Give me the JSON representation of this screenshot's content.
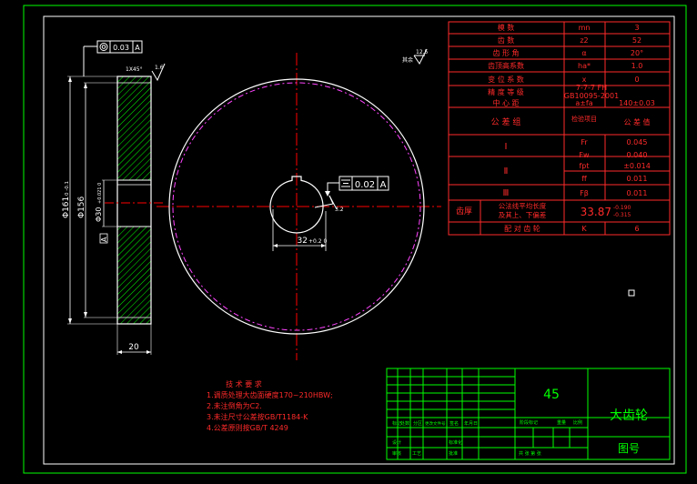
{
  "gear_table": {
    "rows": [
      {
        "label": "模 数",
        "symbol": "mn",
        "value": "3"
      },
      {
        "label": "齿 数",
        "symbol": "z2",
        "value": "52"
      },
      {
        "label": "齿 形 角",
        "symbol": "α",
        "value": "20°"
      },
      {
        "label": "齿顶高系数",
        "symbol": "ha*",
        "value": "1.0"
      },
      {
        "label": "变 位 系 数",
        "symbol": "x",
        "value": "0"
      },
      {
        "label": "精 度 等 级",
        "symbol": "",
        "value": "7-7-7 FH"
      },
      {
        "label": "",
        "symbol": "",
        "value": "GB10095-2001"
      },
      {
        "label": "中 心 距",
        "symbol": "a±fa",
        "value": "140±0.03"
      }
    ],
    "tolerance_header": {
      "group": "公 差 组",
      "item": "检验项目",
      "value": "公 差 值"
    },
    "groups": [
      "Ⅰ",
      "Ⅱ",
      "Ⅲ"
    ],
    "tolerance_rows": [
      {
        "symbol": "Fr",
        "value": "0.045"
      },
      {
        "symbol": "Fw",
        "value": "0.040"
      },
      {
        "symbol": "fpt",
        "value": "±0.014"
      },
      {
        "symbol": "ff",
        "value": "0.011"
      },
      {
        "symbol": "Fβ",
        "value": "0.011"
      }
    ],
    "tooth_thickness": {
      "left": "齿厚",
      "desc1": "公法线平均长度",
      "desc2": "及其上、下偏差",
      "value": "33.87",
      "upper": "-0.190",
      "lower": "-0.315"
    },
    "mate": {
      "label": "配 对 齿 轮",
      "symbol": "K",
      "value": "6"
    }
  },
  "dimensions": {
    "tol_frame1": "0.03",
    "tol_frame1_ref": "A",
    "chamfer": "1X45°",
    "rough1": "1.6",
    "rough_rest": "12.5",
    "rest_label": "其余",
    "dia_outer": "Φ161",
    "dia_outer_tol": "0 -0.1",
    "dia_mid": "Φ156",
    "dia_bore": "Φ30",
    "dia_bore_tol": "+0.021 0",
    "datum": "A",
    "width": "20",
    "keyway": "32",
    "keyway_tol": "+0.2 0",
    "tol_frame2": "0.02",
    "tol_frame2_ref": "A",
    "rough2": "3.2"
  },
  "tech_notes": {
    "title": "技 术 要 求",
    "items": [
      "1.调质处理大齿面硬度170~210HBW;",
      "2.未注倒角为C2.",
      "3.未注尺寸公差按GB/T1184-K",
      "4.公差原则按GB/T 4249"
    ]
  },
  "title_block": {
    "material": "45",
    "name": "大齿轮",
    "drawing_no_label": "图号",
    "small_labels": [
      "标记",
      "处数",
      "分区",
      "更改文件号",
      "签名",
      "年月日",
      "设计",
      "标准化",
      "阶段标记",
      "重量",
      "比例",
      "审核",
      "工艺",
      "批准",
      "共 张 第 张"
    ]
  },
  "colors": {
    "frame": "#00ff00",
    "lines": "#ffffff",
    "text": "#ff2a2a",
    "center": "#ff0000",
    "hatch": "#00ff00",
    "addendum": "#ff44ff"
  }
}
